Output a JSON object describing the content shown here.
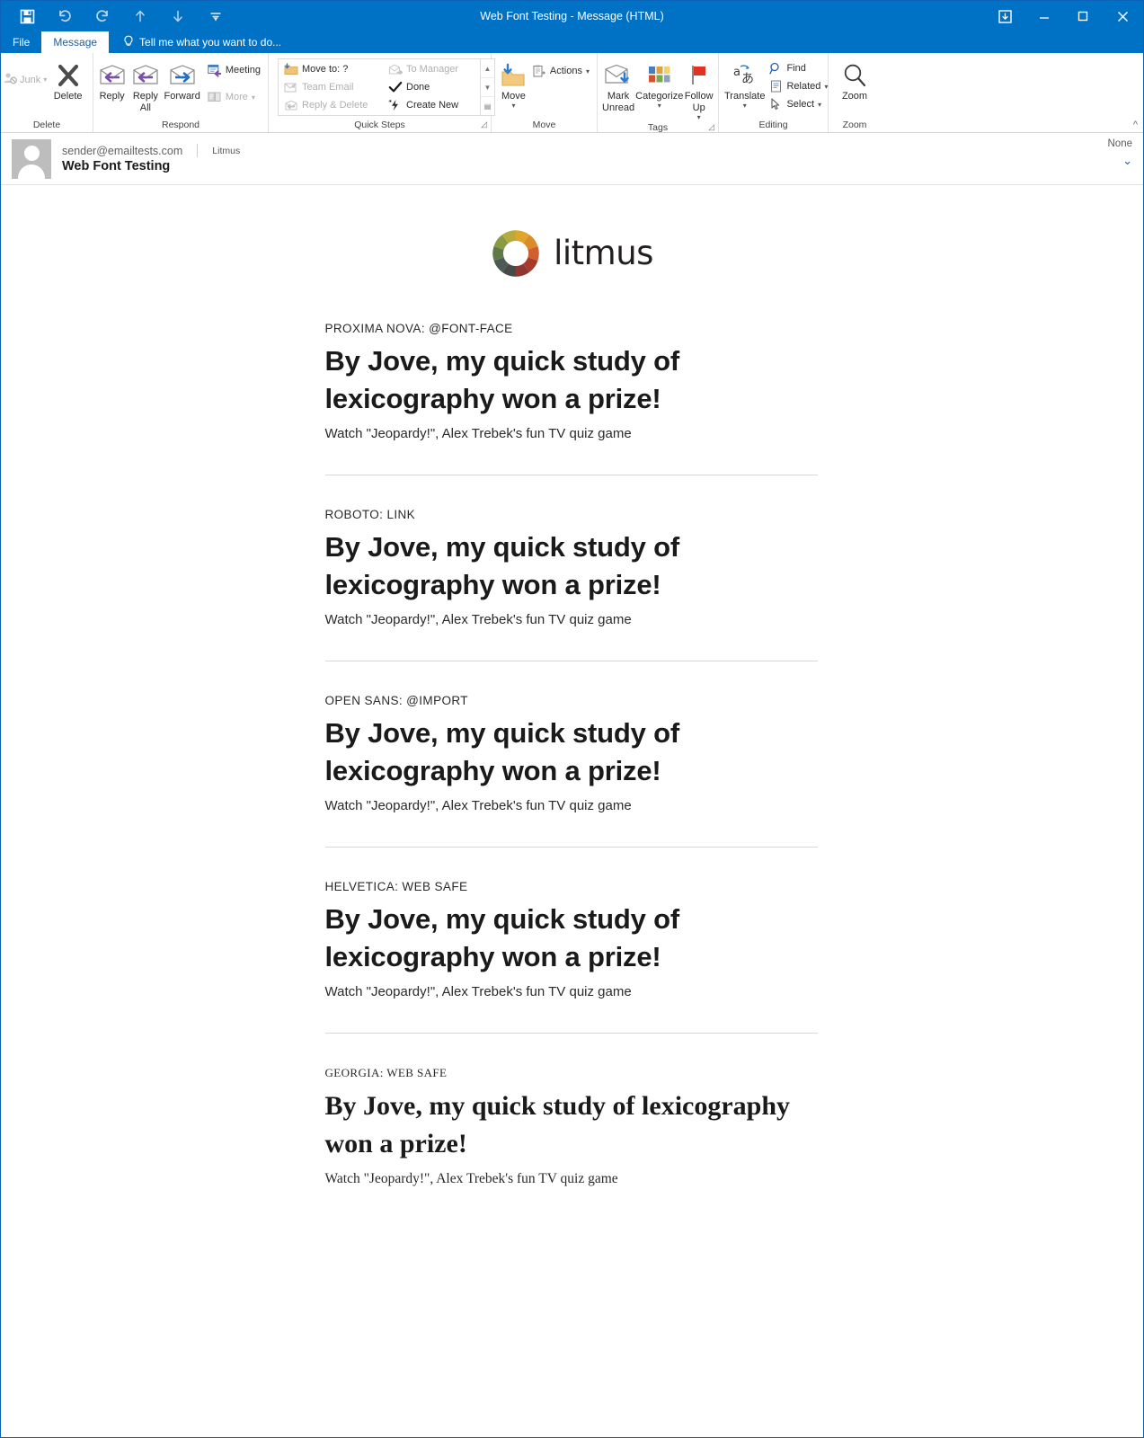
{
  "window": {
    "title": "Web Font Testing - Message (HTML)",
    "quick_access": [
      {
        "name": "save-icon",
        "label": "Save"
      },
      {
        "name": "undo-icon",
        "label": "Undo"
      },
      {
        "name": "redo-icon",
        "label": "Redo"
      },
      {
        "name": "previous-item-icon",
        "label": "Previous Item"
      },
      {
        "name": "next-item-icon",
        "label": "Next Item"
      },
      {
        "name": "customize-quick-access-toolbar-icon",
        "label": "Customize Quick Access Toolbar"
      }
    ],
    "controls": [
      {
        "name": "touch-mode-icon",
        "label": "Touch/Mouse Mode"
      },
      {
        "name": "minimize-icon",
        "label": "Minimize"
      },
      {
        "name": "maximize-icon",
        "label": "Maximize"
      },
      {
        "name": "close-icon",
        "label": "Close"
      }
    ]
  },
  "tabs": {
    "file": "File",
    "message": "Message",
    "tell_me": "Tell me what you want to do..."
  },
  "ribbon": {
    "collapse_label": "^",
    "groups": [
      {
        "label": "Delete",
        "items": [
          {
            "label": "Junk",
            "icon": "junk-icon",
            "dropdown": true,
            "disabled": true
          },
          {
            "label": "Delete",
            "icon": "delete-x-icon",
            "dropdown": false,
            "disabled": false
          }
        ]
      },
      {
        "label": "Respond",
        "items": [
          {
            "label": "Reply",
            "icon": "reply-icon"
          },
          {
            "label": "Reply\nAll",
            "icon": "reply-all-icon"
          },
          {
            "label": "Forward",
            "icon": "forward-icon"
          },
          {
            "label": "Meeting",
            "icon": "meeting-icon"
          },
          {
            "label": "More",
            "icon": "more-icon",
            "dropdown": true,
            "disabled": true
          }
        ]
      },
      {
        "label": "Quick Steps",
        "items": [
          {
            "label": "Move to: ?",
            "icon": "move-to-folder-icon",
            "disabled": false
          },
          {
            "label": "To Manager",
            "icon": "to-manager-icon",
            "disabled": true
          },
          {
            "label": "Team Email",
            "icon": "team-email-icon",
            "disabled": true
          },
          {
            "label": "Done",
            "icon": "done-check-icon",
            "disabled": false
          },
          {
            "label": "Reply & Delete",
            "icon": "reply-and-delete-icon",
            "disabled": true
          },
          {
            "label": "Create New",
            "icon": "create-new-icon",
            "disabled": false
          }
        ]
      },
      {
        "label": "Move",
        "items": [
          {
            "label": "Move",
            "icon": "move-folder-icon",
            "dropdown": true
          },
          {
            "label": "Actions",
            "icon": "actions-icon",
            "dropdown": true
          }
        ]
      },
      {
        "label": "Tags",
        "items": [
          {
            "label": "Mark\nUnread",
            "icon": "mark-unread-icon"
          },
          {
            "label": "Categorize",
            "icon": "categorize-icon",
            "dropdown": true
          },
          {
            "label": "Follow\nUp",
            "icon": "follow-up-flag-icon",
            "dropdown": true
          }
        ]
      },
      {
        "label": "Editing",
        "items": [
          {
            "label": "Translate",
            "icon": "translate-icon",
            "dropdown": true
          },
          {
            "label": "Find",
            "icon": "find-icon"
          },
          {
            "label": "Related",
            "icon": "related-icon",
            "dropdown": true
          },
          {
            "label": "Select",
            "icon": "select-cursor-icon",
            "dropdown": true
          }
        ]
      },
      {
        "label": "Zoom",
        "items": [
          {
            "label": "Zoom",
            "icon": "zoom-magnifier-icon"
          }
        ]
      }
    ]
  },
  "message": {
    "sender": "sender@emailtests.com",
    "to": "Litmus",
    "subject": "Web Font Testing",
    "category": "None"
  },
  "email": {
    "logo_word": "litmus",
    "logo_colors": [
      "#d9a32c",
      "#e8a126",
      "#d4612f",
      "#c0452f",
      "#9e3230",
      "#4d4d4a",
      "#4f5a51",
      "#5e7346",
      "#7b8f3e",
      "#b0ae3f"
    ],
    "sections": [
      {
        "label": "PROXIMA NOVA: @FONT-FACE",
        "heading": "By Jove, my quick study of lexicography won a prize!",
        "subtext": "Watch \"Jeopardy!\", Alex Trebek's fun TV quiz game",
        "style": "sans"
      },
      {
        "label": "ROBOTO: LINK",
        "heading": "By Jove, my quick study of lexicography won a prize!",
        "subtext": "Watch \"Jeopardy!\", Alex Trebek's fun TV quiz game",
        "style": "sans"
      },
      {
        "label": "OPEN SANS: @IMPORT",
        "heading": "By Jove, my quick study of lexicography won a prize!",
        "subtext": "Watch \"Jeopardy!\", Alex Trebek's fun TV quiz game",
        "style": "sans"
      },
      {
        "label": "HELVETICA: WEB SAFE",
        "heading": "By Jove, my quick study of lexicography won a prize!",
        "subtext": "Watch \"Jeopardy!\", Alex Trebek's fun TV quiz game",
        "style": "sans"
      },
      {
        "label": "GEORGIA: WEB SAFE",
        "heading": "By Jove, my quick study of lexicography won a prize!",
        "subtext": "Watch \"Jeopardy!\", Alex Trebek's fun TV quiz game",
        "style": "serif"
      }
    ]
  },
  "colors": {
    "titlebar": "#0072c6",
    "accent_blue": "#1b5b9e",
    "divider": "#d8d8d8"
  }
}
